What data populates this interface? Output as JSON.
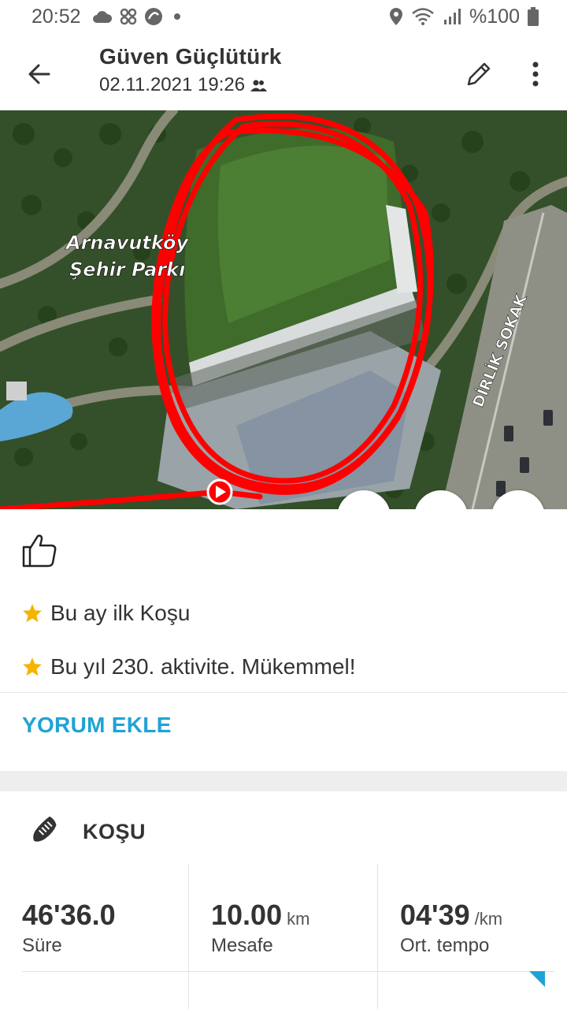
{
  "status_bar": {
    "time": "20:52",
    "battery": "%100"
  },
  "header": {
    "title": "Güven Güçlütürk",
    "datetime": "02.11.2021 19:26"
  },
  "map": {
    "park_label_line1": "Arnavutköy",
    "park_label_line2": "Şehir Parkı",
    "street_label": "DİRLİK SOKAK"
  },
  "achievements": [
    {
      "text": "Bu ay ilk Koşu"
    },
    {
      "text": "Bu yıl 230. aktivite. Mükemmel!"
    }
  ],
  "comment_button": "YORUM EKLE",
  "activity": {
    "sport": "KOŞU",
    "stats": [
      {
        "value": "46'36.0",
        "unit": "",
        "label": "Süre"
      },
      {
        "value": "10.00",
        "unit": "km",
        "label": "Mesafe"
      },
      {
        "value": "04'39",
        "unit": "/km",
        "label": "Ort. tempo"
      }
    ]
  },
  "colors": {
    "accent": "#1fa3d6",
    "route": "#ff0000",
    "star": "#f5b400"
  }
}
